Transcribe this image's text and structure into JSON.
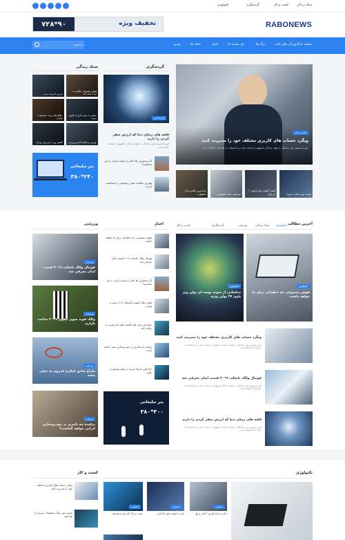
{
  "topbar": {
    "nav": [
      "سبک زندگی",
      "کسب و کار",
      "گردشگری",
      "تکنولوژی"
    ],
    "brand_colors": {
      "accent": "#2c80f0",
      "dark": "#1c2a4a"
    }
  },
  "header": {
    "logo": "RABONEWS",
    "banner_number": "۷۲۸*۹۰",
    "banner_text": "تخفیف ویژه"
  },
  "nav": {
    "items": [
      "صفحه خانگی",
      "ویژگی های قالب",
      "برگه ها",
      "تک نوشته ها",
      "اخبار",
      "مقاله ها",
      "ویدیو"
    ],
    "search_placeholder": "جستجو..."
  },
  "hero": {
    "badge": "کسب و کار",
    "title": "ویگرد حساب های کاربری مختلف خود را مدیریت کنید",
    "excerpt": "لورم ایپسوم متن ساختگی با تولید سادگی نامفهوم از صنعت چاپ و با استفاده از طراحان گرافیک است."
  },
  "hero_strip": [
    {
      "title": "جدیدترین عکس ها از جشنواره"
    },
    {
      "title": "خبرهای دنیای تکنولوژی"
    },
    {
      "title": "قیمت گوشی های آیفون ۱۱ در بازار"
    },
    {
      "title": "بیست تور سالانه با ویژه"
    }
  ],
  "travel": {
    "title": "گردشگری",
    "main_badge": "گردشگری",
    "main_title": "قلعه های زیبای دنیا که ارزش سفر کردن را دارند",
    "main_excerpt": "لورم ایپسوم متن ساختگی با تولید سادگی نامفهوم از صنعت چاپ است.",
    "items": [
      {
        "title": "آیا پرمصرف ها عالی و عجیب ایران را می شناسید؟"
      },
      {
        "title": "بهترین مقاصد سفر زمستانی را بشناسید ایران"
      }
    ]
  },
  "lifestyle": {
    "title": "سبک زندگی",
    "tiles": [
      {
        "title": "تمرین با تربیت بدنی"
      },
      {
        "title": "هوش مصنوعی چگونه به آینده کمک کند"
      },
      {
        "title": "راهکارهای رشد محصولات تولیدی"
      },
      {
        "title": "چطور به سفر خارج از کشور برویم"
      },
      {
        "title": "کاهش وزن با ورزش روزانه"
      },
      {
        "title": "بهترین برندهای لباس ورزشی"
      }
    ],
    "ad_title": "بنر تبلیغاتی",
    "ad_size": "۳۸۰*۲۴۰"
  },
  "latest": {
    "title": "آخرین مطالب",
    "tabs": [
      "تکنولوژی",
      "سبک زندگی",
      "ورزشی",
      "گردشگری",
      "کسب و کار"
    ],
    "cards": [
      {
        "badge": "تکنولوژی",
        "title": "هوش مصنوعی چه خطراتی برای ما خواهد داشت"
      },
      {
        "badge": "تکنولوژی",
        "title": "تماشایی از نمونه توسه ای پولن ویژ یاوی ۲۷ پولن ویژه"
      }
    ],
    "list": [
      {
        "title": "ویگرد حساب های کاربری مختلف خود را مدیریت کنید",
        "excerpt": "لورم ایپسوم متن ساختگی با تولید سادگی نامفهوم از صنعت چاپ و با استفاده از طراحان گرافیک است."
      },
      {
        "title": "فوتبال والک یاسکت ۲۰۱۹ قیمت اینان معرفی شد",
        "excerpt": "لورم ایپسوم متن ساختگی با تولید سادگی نامفهوم از صنعت چاپ و با استفاده از طراحان گرافیک است."
      },
      {
        "title": "قلعه های زیبای دنیا که ارزش سفر کردن را دارند",
        "excerpt": "لورم ایپسوم متن ساختگی با تولید سادگی نامفهوم از صنعت چاپ و با استفاده از طراحان گرافیک است."
      }
    ]
  },
  "news": {
    "title": "اخبار",
    "items": [
      {
        "title": "هوش مصنوعی چه خطراتی برای ما خواهد داشت"
      },
      {
        "title": "فوتبال والک یاسکت ۲۰۱۹ قیمت اینان معرفی شد"
      },
      {
        "title": "آیا پرمصرف ها عالی و عجیب ایران را می شناسید؟"
      },
      {
        "title": "قیمت های کیفیت آپارتمان تا ۲ درصد در تهران"
      },
      {
        "title": "سفارش برای های گفتنده های امن فریب و رفانه دانید"
      },
      {
        "title": "برقیده چه تاثیری بر خودروسازی یعنی داشته است"
      },
      {
        "title": "داخ طرز فریقا حزیف از تولید توضیح در طرح"
      }
    ],
    "ad_title": "بنر تبلیغاتی",
    "ad_size": "۳۸۰*۳۰۰"
  },
  "sports": {
    "title": "ورزشی",
    "cards": [
      {
        "badge": "ورزشی",
        "title": "فوتبال والک یاسکت ۲۰۱۹ قیمت اینان معرفی شد"
      },
      {
        "badge": "ورزشی",
        "title": "والک فوید سوپر آیفون ۲۰۱۹ ساعت بازاری"
      },
      {
        "badge": "ورزشی",
        "title": "طراح سایق فیکرم اندرون به جیلی پیشد"
      },
      {
        "badge": "ورزشی",
        "title": "برقیده چه تاثیری بر خودروسازی ایرانی خواهد گذاشت؟"
      }
    ]
  },
  "bottom": {
    "tech_title": "تکنولوژی",
    "business_title": "کسب و کار",
    "business_items": [
      {
        "title": "ویگرد حساب های کاربری مختلف خود را مدیریت کنید"
      },
      {
        "title": "بیست تور رینگ محصولات سرمه را هم کنید"
      }
    ],
    "tech_cards": [
      {
        "badge": "تکنولوژی",
        "title": "داکن به ایانا کلیری ۲ کلی و نوار"
      },
      {
        "badge": "تکنولوژی",
        "title": "کینی ۷ قیمت های بالا قابی"
      },
      {
        "badge": "تکنولوژی",
        "title": "سایت بزرگ گنه بچه و نمایشی"
      },
      {
        "badge": "تکنولوژی",
        "title": "ماه ساتی مثل با تنها می شن"
      }
    ]
  }
}
